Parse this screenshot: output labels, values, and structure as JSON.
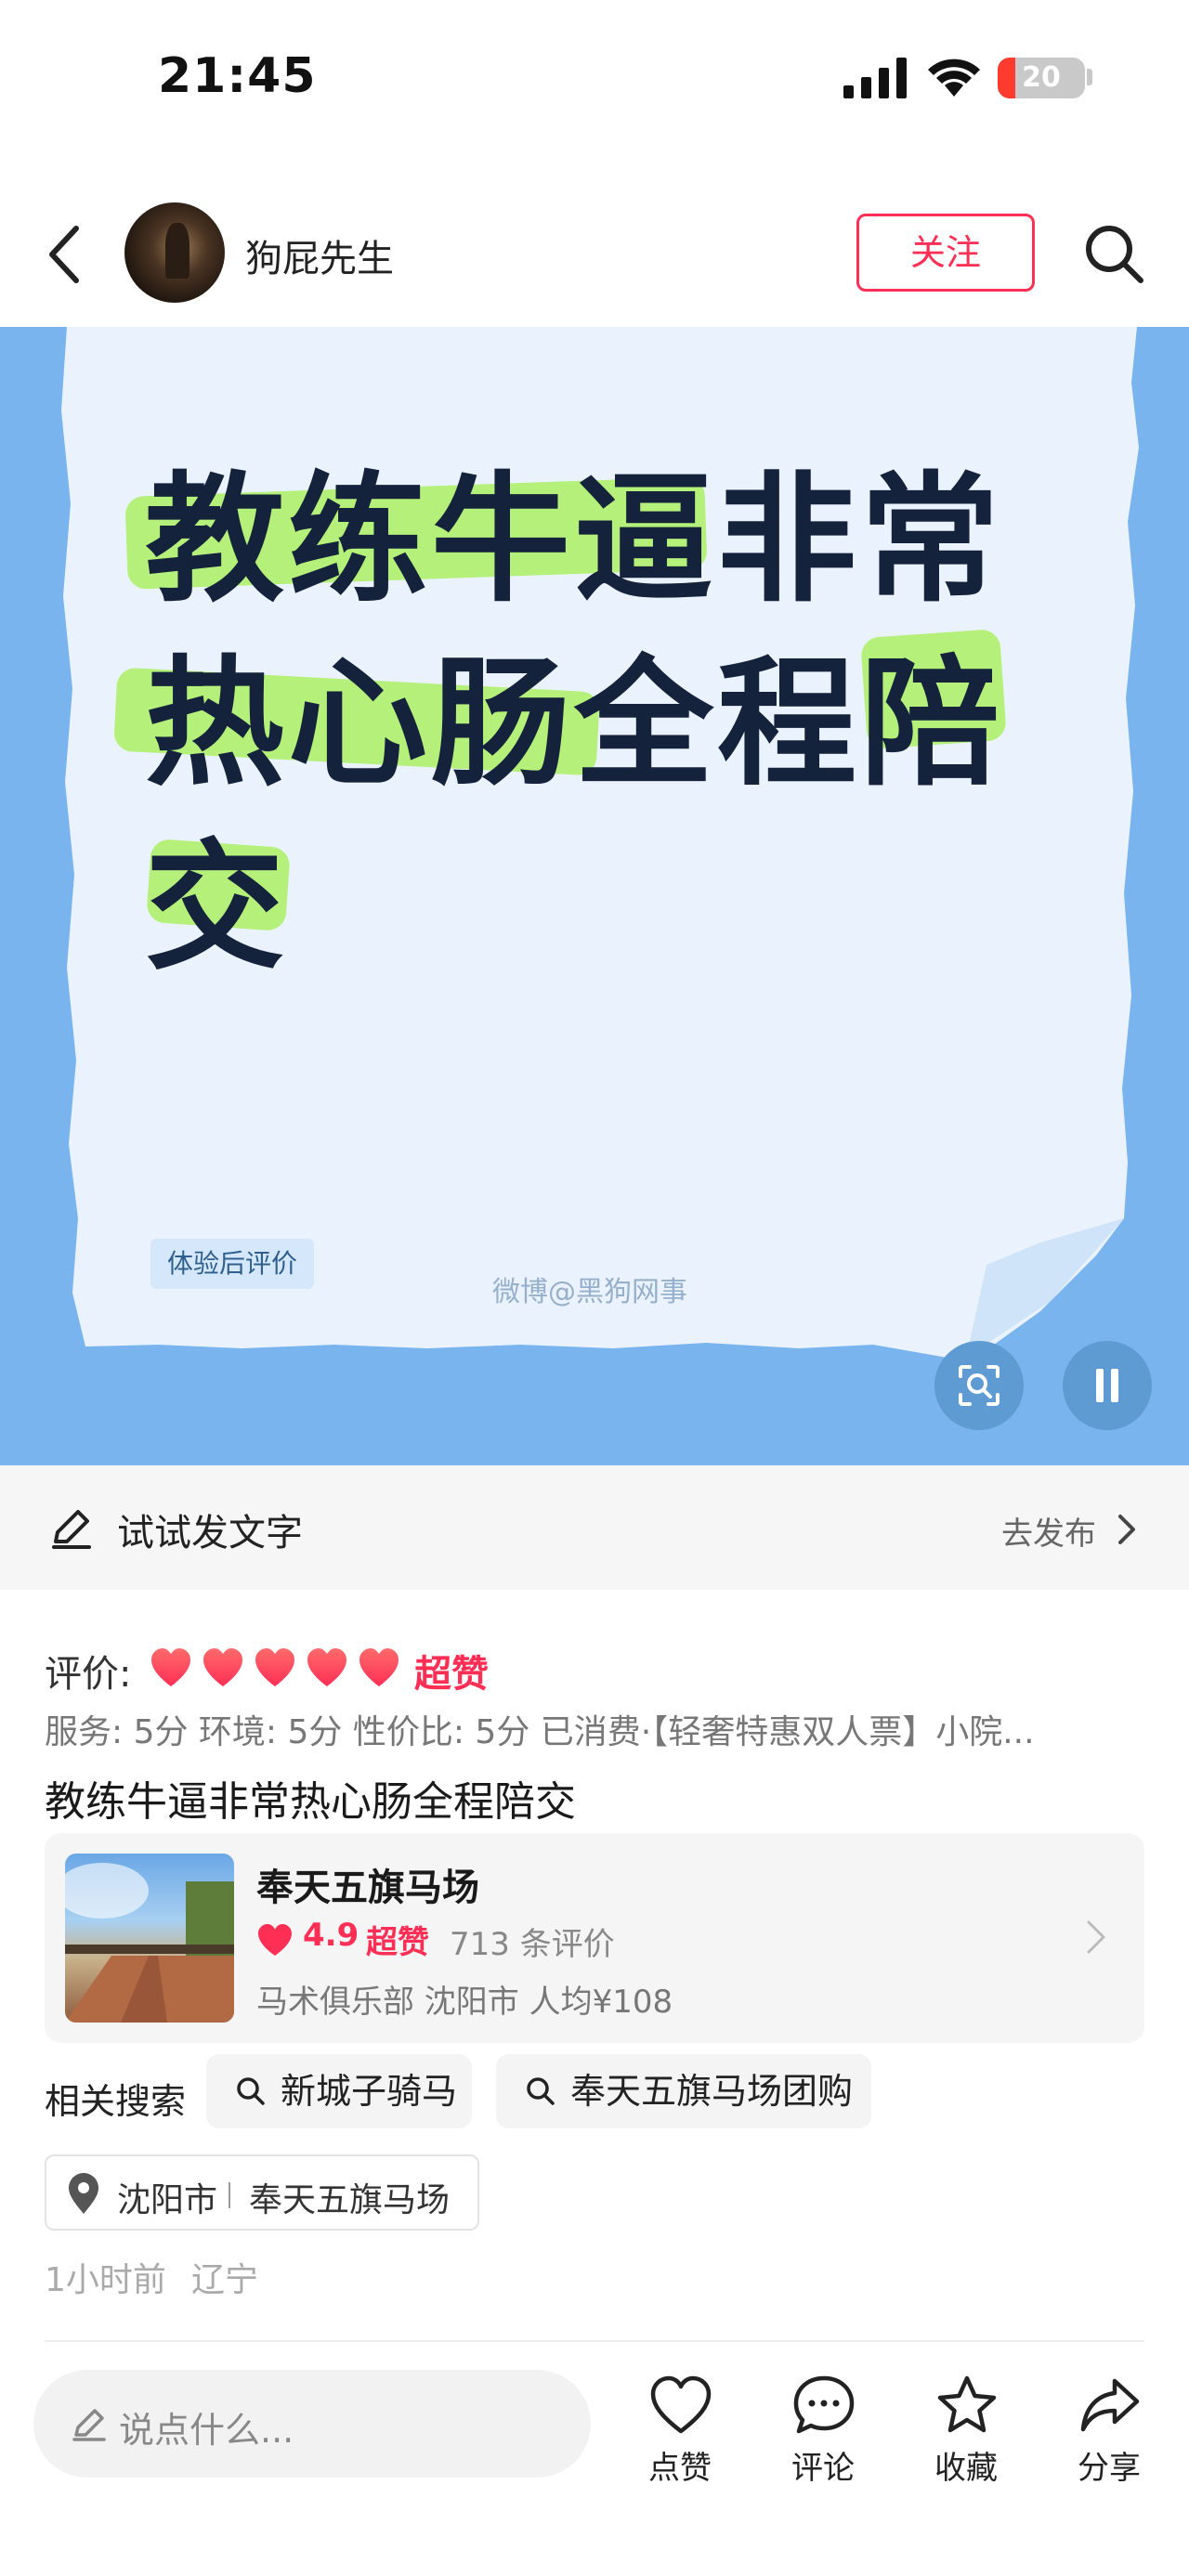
{
  "status_bar": {
    "time": "21:45",
    "battery": "20",
    "battery_level": 0.2
  },
  "header": {
    "user_name": "狗屁先生",
    "follow_label": "关注"
  },
  "hero": {
    "lines": [
      "教练牛逼非常",
      "热心肠全程陪",
      "交"
    ],
    "tag": "体验后评价",
    "watermark": "微博@黑狗网事",
    "colors": {
      "background": "#79b4ef",
      "paper": "#eaf3fd",
      "highlight": "#b4f07a",
      "text": "#14223b"
    }
  },
  "compose": {
    "label": "试试发文字",
    "publish": "去发布"
  },
  "review": {
    "rating_label": "评价:",
    "hearts": 5,
    "rating_text": "超赞",
    "details": "服务: 5分 环境: 5分 性价比: 5分 已消费·【轻奢特惠双人票】小院...",
    "title": "教练牛逼非常热心肠全程陪交"
  },
  "poi": {
    "name": "奉天五旗马场",
    "score": "4.9",
    "score_label": "超赞",
    "reviews": "713 条评价",
    "meta": "马术俱乐部 沈阳市 人均¥108"
  },
  "related": {
    "label": "相关搜索",
    "chips": [
      "新城子骑马",
      "奉天五旗马场团购"
    ]
  },
  "location": {
    "city": "沈阳市",
    "place": "奉天五旗马场"
  },
  "meta": {
    "time": "1小时前",
    "region": "辽宁"
  },
  "bottom_bar": {
    "comment_placeholder": "说点什么...",
    "actions": [
      "点赞",
      "评论",
      "收藏",
      "分享"
    ]
  },
  "accent_color": "#ff2e55"
}
